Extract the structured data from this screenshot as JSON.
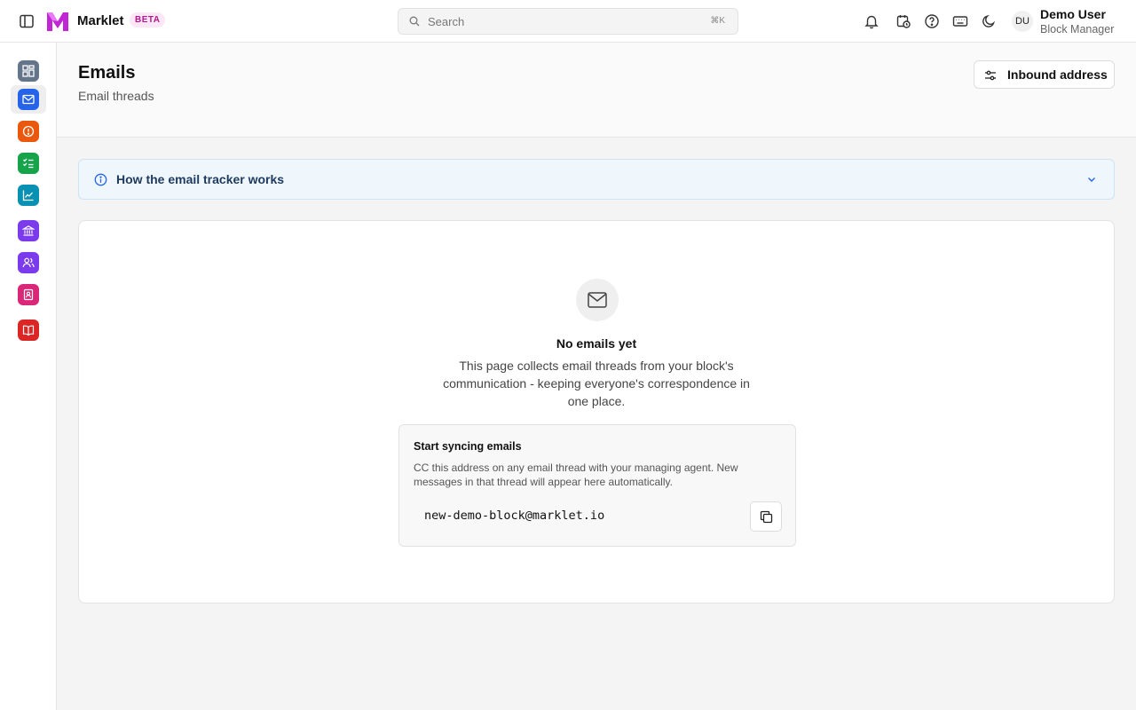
{
  "app": {
    "name": "Marklet",
    "badge": "BETA"
  },
  "search": {
    "placeholder": "Search",
    "shortcut": "⌘K"
  },
  "topbar_icons": [
    "bell-icon",
    "calendar-clock-icon",
    "help-circle-icon",
    "keyboard-icon",
    "moon-icon"
  ],
  "user": {
    "initials": "DU",
    "name": "Demo User",
    "role": "Block Manager"
  },
  "rail": {
    "active": "emails",
    "items": [
      {
        "id": "dashboard",
        "icon": "dashboard-icon",
        "color": "#64748b"
      },
      {
        "id": "emails",
        "icon": "mail-icon",
        "color": "#2563eb"
      },
      {
        "id": "issues",
        "icon": "alert-circle-icon",
        "color": "#ea580c"
      },
      {
        "id": "tasks",
        "icon": "checklist-icon",
        "color": "#16a34a"
      },
      {
        "id": "analytics",
        "icon": "chart-line-icon",
        "color": "#0891b2"
      },
      {
        "id": "finance",
        "icon": "bank-icon",
        "color": "#7c3aed"
      },
      {
        "id": "people",
        "icon": "users-icon",
        "color": "#7c3aed"
      },
      {
        "id": "contacts",
        "icon": "contact-card-icon",
        "color": "#db2777"
      },
      {
        "id": "docs",
        "icon": "book-icon",
        "color": "#dc2626"
      }
    ]
  },
  "page": {
    "title": "Emails",
    "subtitle": "Email threads",
    "action_button": "Inbound address"
  },
  "info_panel": {
    "title": "How the email tracker works",
    "expanded": false
  },
  "empty_state": {
    "title": "No emails yet",
    "description": "This page collects email threads from your block's communication - keeping everyone's correspondence in one place."
  },
  "sync": {
    "title": "Start syncing emails",
    "description": "CC this address on any email thread with your managing agent. New messages in that thread will appear here automatically.",
    "address": "new-demo-block@marklet.io"
  },
  "colors": {
    "brand": "#c026d3",
    "info_bg": "#eff6fc",
    "info_text": "#1e3a5f"
  }
}
